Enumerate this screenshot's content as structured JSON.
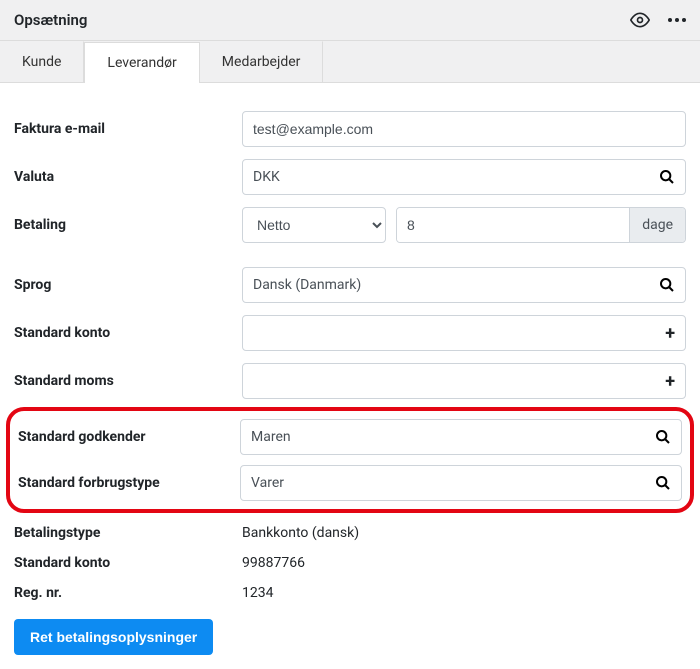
{
  "header": {
    "title": "Opsætning"
  },
  "tabs": {
    "items": [
      {
        "label": "Kunde"
      },
      {
        "label": "Leverandør"
      },
      {
        "label": "Medarbejder"
      }
    ],
    "active_index": 1
  },
  "form": {
    "invoice_email": {
      "label": "Faktura e-mail",
      "value": "test@example.com"
    },
    "currency": {
      "label": "Valuta",
      "value": "DKK"
    },
    "payment": {
      "label": "Betaling",
      "terms": "Netto",
      "days": "8",
      "days_suffix": "dage"
    },
    "language": {
      "label": "Sprog",
      "value": "Dansk (Danmark)"
    },
    "default_account": {
      "label": "Standard konto",
      "value": ""
    },
    "default_vat": {
      "label": "Standard moms",
      "value": ""
    },
    "default_approver": {
      "label": "Standard godkender",
      "value": "Maren"
    },
    "default_consumption_type": {
      "label": "Standard forbrugstype",
      "value": "Varer"
    },
    "payment_type": {
      "label": "Betalingstype",
      "value": "Bankkonto (dansk)"
    },
    "default_account_static": {
      "label": "Standard konto",
      "value": "99887766"
    },
    "reg_no": {
      "label": "Reg. nr.",
      "value": "1234"
    },
    "edit_button": "Ret betalingsoplysninger"
  }
}
